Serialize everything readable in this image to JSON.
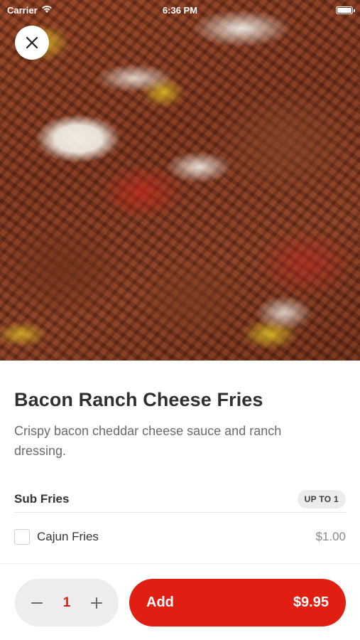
{
  "status_bar": {
    "carrier": "Carrier",
    "time": "6:36 PM"
  },
  "hero": {
    "image_icon": "food-photo"
  },
  "item": {
    "title": "Bacon Ranch Cheese Fries",
    "description": "Crispy bacon cheddar cheese sauce and ranch dressing."
  },
  "modifier_group": {
    "title": "Sub Fries",
    "badge": "UP TO 1",
    "options": [
      {
        "label": "Cajun Fries",
        "price": "$1.00",
        "checked": false
      }
    ]
  },
  "footer": {
    "quantity": "1",
    "add_label": "Add",
    "total": "$9.95"
  },
  "colors": {
    "accent": "#e01e12",
    "quantity_text": "#d62012"
  }
}
